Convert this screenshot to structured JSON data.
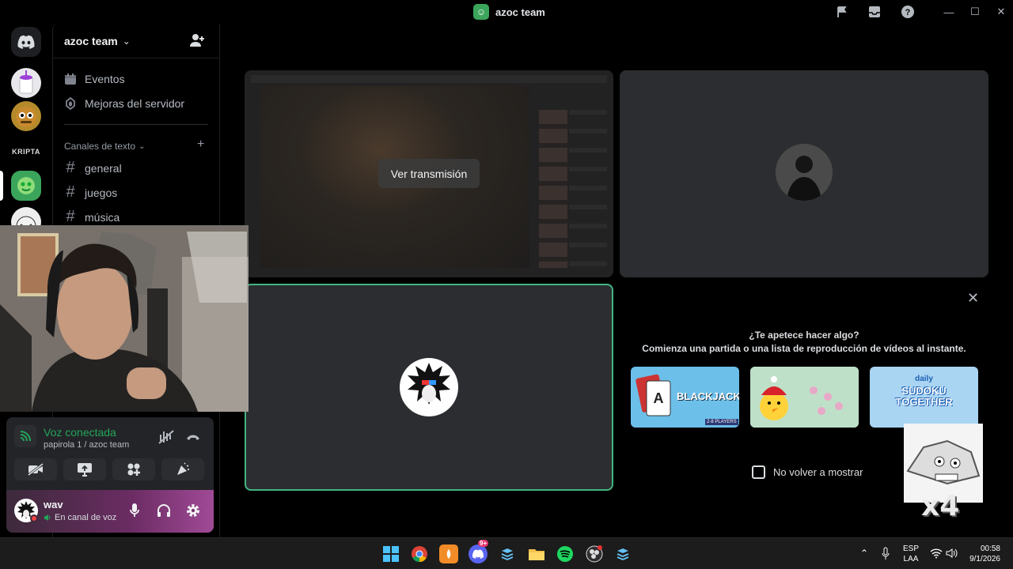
{
  "window": {
    "title": "azoc team"
  },
  "server": {
    "name": "azoc team",
    "items": [
      {
        "label": "Eventos",
        "icon": "calendar-icon"
      },
      {
        "label": "Mejoras del servidor",
        "icon": "boost-icon"
      }
    ],
    "category": "Canales de texto",
    "channels": [
      "general",
      "juegos",
      "música"
    ]
  },
  "stream": {
    "watch_label": "Ver transmisión"
  },
  "activities": {
    "title": "¿Te apetece hacer algo?",
    "subtitle": "Comienza una partida o una lista de reproducción de vídeos al instante.",
    "cards": [
      {
        "name": "BLACKJACK",
        "badge": "2-8 PLAYERS"
      },
      {
        "name": ""
      },
      {
        "name": "SUDOKU TOGETHER",
        "top": "daily"
      }
    ],
    "dont_show": "No volver a mostrar"
  },
  "overlay": {
    "counter": "x4"
  },
  "voice": {
    "status": "Voz conectada",
    "channel": "papirola 1 / azoc team"
  },
  "user": {
    "name": "wav",
    "status": "En canal de voz"
  },
  "taskbar": {
    "lang_top": "ESP",
    "lang_bottom": "LAA",
    "time": "00:58",
    "date": "9/1/2026",
    "discord_badge": "9+"
  },
  "colors": {
    "accent_green": "#3ba55c",
    "speaking_border": "#43b581",
    "tile_bg": "#2b2d31",
    "panel_bg": "#232428"
  }
}
